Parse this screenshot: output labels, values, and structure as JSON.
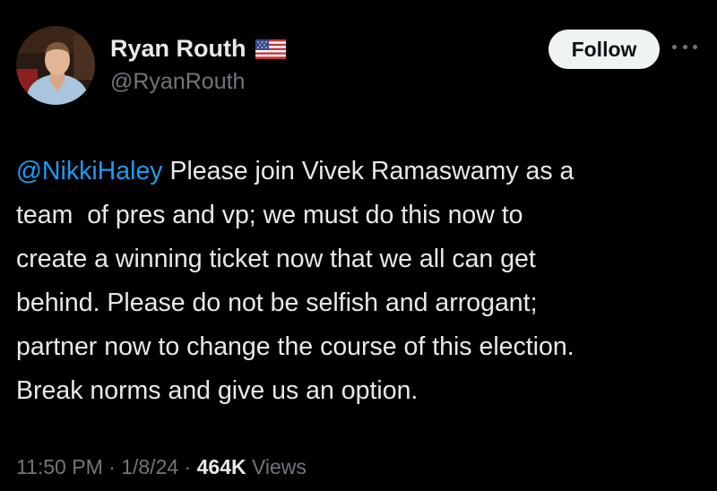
{
  "author": {
    "display_name": "Ryan Routh",
    "handle": "@RyanRouth",
    "avatar_icon": "profile-photo",
    "flag_icon": "us-flag-icon"
  },
  "follow_button": {
    "label": "Follow"
  },
  "more_icon": "more-options-icon",
  "tweet": {
    "mention": "@NikkiHaley",
    "body": " Please join Vivek Ramaswamy as a\nteam  of pres and vp; we must do this now to\ncreate a winning ticket now that we all can get\nbehind. Please do not be selfish and arrogant;\npartner now to change the course of this election.\nBreak norms and give us an option."
  },
  "meta": {
    "time": "11:50 PM",
    "separator1": " · ",
    "date": "1/8/24",
    "separator2": " · ",
    "views_count": "464K",
    "views_label": " Views"
  },
  "colors": {
    "background": "#000000",
    "text": "#e7e9ea",
    "secondary": "#71767b",
    "link": "#1d9bf0",
    "button_bg": "#eff3f4"
  }
}
